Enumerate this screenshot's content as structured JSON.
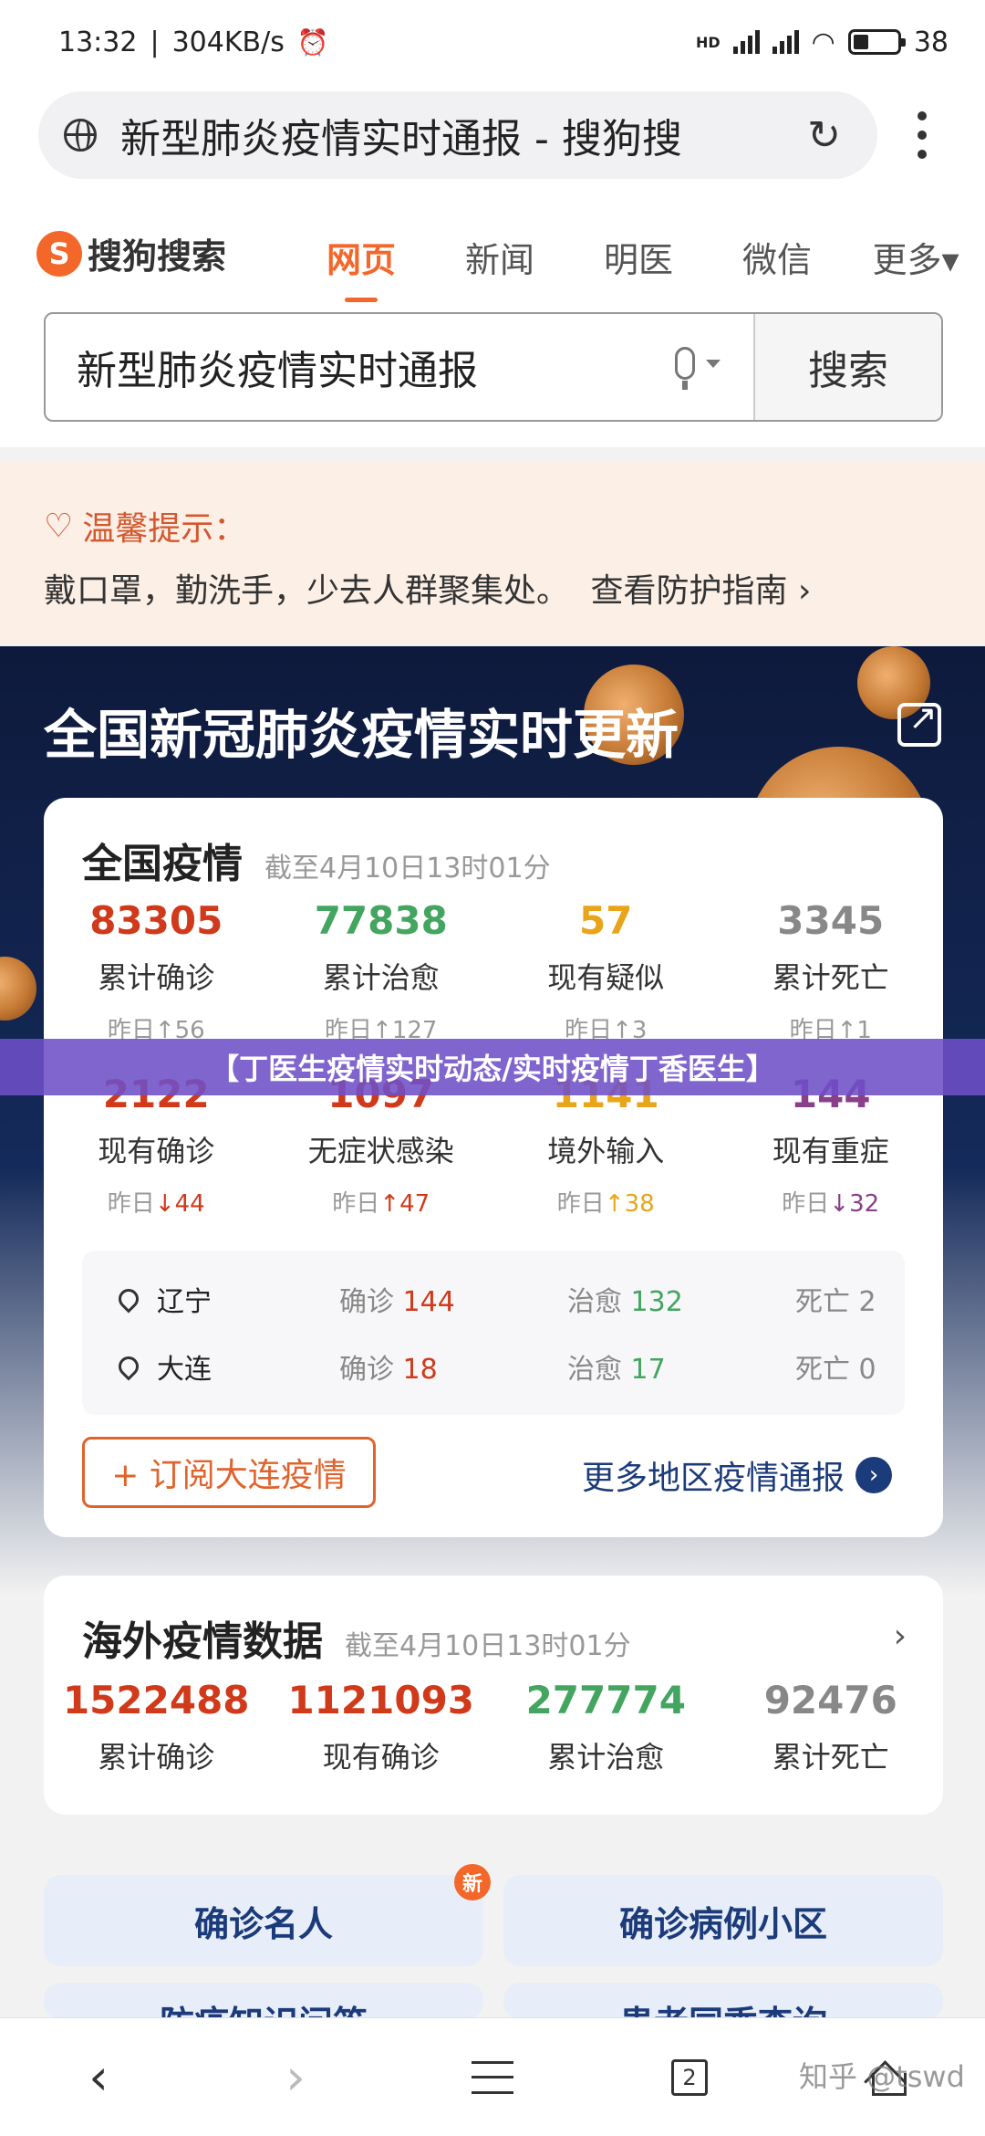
{
  "status_bar": {
    "time": "13:32",
    "speed": "304KB/s",
    "network": "HD",
    "battery": "38"
  },
  "browser": {
    "url_title": "新型肺炎疫情实时通报 - 搜狗搜",
    "reload_icon": "↻"
  },
  "sogou": {
    "logo_text": "搜狗搜索",
    "logo_mark": "S",
    "tabs": [
      "网页",
      "新闻",
      "明医",
      "微信",
      "更多▾"
    ],
    "search_query": "新型肺炎疫情实时通报",
    "search_button": "搜索"
  },
  "tip": {
    "title": "温馨提示：",
    "text": "戴口罩，勤洗手，少去人群聚集处。",
    "link": "查看防护指南",
    "link_arrow": "›"
  },
  "section_title": "全国新冠肺炎疫情实时更新",
  "national": {
    "title": "全国疫情",
    "as_of": "截至4月10日13时01分",
    "row1": [
      {
        "value": "83305",
        "label": "累计确诊",
        "change": "昨日↑56"
      },
      {
        "value": "77838",
        "label": "累计治愈",
        "change": "昨日↑127"
      },
      {
        "value": "57",
        "label": "现有疑似",
        "change": "昨日↑3"
      },
      {
        "value": "3345",
        "label": "累计死亡",
        "change": "昨日↑1"
      }
    ],
    "row2": [
      {
        "value": "2122",
        "label": "现有确诊",
        "change_prefix": "昨日",
        "change": "↓44"
      },
      {
        "value": "1097",
        "label": "无症状感染",
        "change_prefix": "昨日",
        "change": "↑47"
      },
      {
        "value": "1141",
        "label": "境外输入",
        "change_prefix": "昨日",
        "change": "↑38"
      },
      {
        "value": "144",
        "label": "现有重症",
        "change_prefix": "昨日",
        "change": "↓32"
      }
    ],
    "cities": [
      {
        "name": "辽宁",
        "confirmed_label": "确诊",
        "confirmed": "144",
        "cured_label": "治愈",
        "cured": "132",
        "dead": "死亡 2"
      },
      {
        "name": "大连",
        "confirmed_label": "确诊",
        "confirmed": "18",
        "cured_label": "治愈",
        "cured": "17",
        "dead": "死亡 0"
      }
    ],
    "subscribe": "+ 订阅大连疫情",
    "more_regions": "更多地区疫情通报",
    "more_arrow": "›"
  },
  "overlay_banner": "【丁医生疫情实时动态/实时疫情丁香医生】",
  "abroad": {
    "title": "海外疫情数据",
    "as_of": "截至4月10日13时01分",
    "chevron": "›",
    "stats": [
      {
        "value": "1522488",
        "label": "累计确诊"
      },
      {
        "value": "1121093",
        "label": "现有确诊"
      },
      {
        "value": "277774",
        "label": "累计治愈"
      },
      {
        "value": "92476",
        "label": "累计死亡"
      }
    ]
  },
  "quick_links": {
    "celebrity": "确诊名人",
    "community": "确诊病例小区",
    "new_badge": "新",
    "partial_left": "防疫知识问答",
    "partial_right": "患者同乘查询"
  },
  "bottom_nav": {
    "back": "‹",
    "forward": "›",
    "tab_count": "2"
  },
  "watermark": "知乎 @tswd"
}
